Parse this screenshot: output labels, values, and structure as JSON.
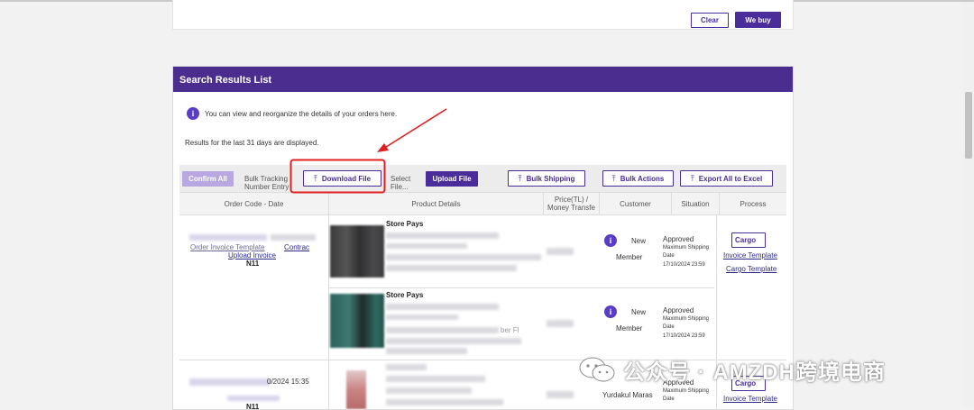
{
  "top_form": {
    "clear_label": "Clear",
    "buy_label": "We buy"
  },
  "panel": {
    "title": "Search Results List",
    "info_text": "You can view and reorganize the details of your orders here.",
    "range_text": "Results for the last 31 days are displayed."
  },
  "toolbar": {
    "confirm_all": "Confirm All",
    "bulk_tracking_line1": "Bulk Tracking",
    "bulk_tracking_line2": "Number Entry",
    "download_file": "Download File",
    "select_file_line1": "Select",
    "select_file_line2": "File...",
    "upload_file": "Upload File",
    "bulk_shipping": "Bulk Shipping",
    "bulk_actions": "Bulk Actions",
    "export_all": "Export All to Excel"
  },
  "table": {
    "headers": {
      "order_code": "Order Code - Date",
      "product_details": "Product Details",
      "price_line1": "Price(TL) /",
      "price_line2": "Money Transfe",
      "customer": "Customer",
      "situation": "Situation",
      "process": "Process"
    },
    "orders": [
      {
        "links": {
          "invoice_template": "Order Invoice Template",
          "contract": "Contrac",
          "upload_invoice": "Upload Invoice"
        },
        "store_code": "N11",
        "items": [
          {
            "seller": "Store Pays",
            "customer_line1": "New",
            "customer_line2": "Member",
            "status": "Approved",
            "max_ship_line1": "Maximum Shipping",
            "max_ship_line2": "Date",
            "max_ship_date": "17/10/2024 23:59"
          },
          {
            "seller": "Store Pays",
            "product_snippet": "ber Fl",
            "customer_line1": "New",
            "customer_line2": "Member",
            "status": "Approved",
            "max_ship_line1": "Maximum Shipping",
            "max_ship_line2": "Date",
            "max_ship_date": "17/10/2024 23:59"
          }
        ],
        "process": {
          "cargo": "Cargo",
          "invoice_template": "Invoice Template",
          "cargo_template": "Cargo Template"
        }
      },
      {
        "date_partial": "0/2024 15:35",
        "store_code": "N11",
        "customer": "Yurdakul Maras",
        "status": "Approved",
        "max_ship_line1": "Maximum Shipping",
        "max_ship_line2": "Date",
        "process": {
          "cargo": "Cargo",
          "invoice_template": "Invoice Template"
        }
      }
    ]
  },
  "watermark": {
    "text": "公众号 · AMZDH跨境电商"
  },
  "colors": {
    "brand_purple": "#4a2d8f",
    "highlight_red": "#e02020"
  }
}
